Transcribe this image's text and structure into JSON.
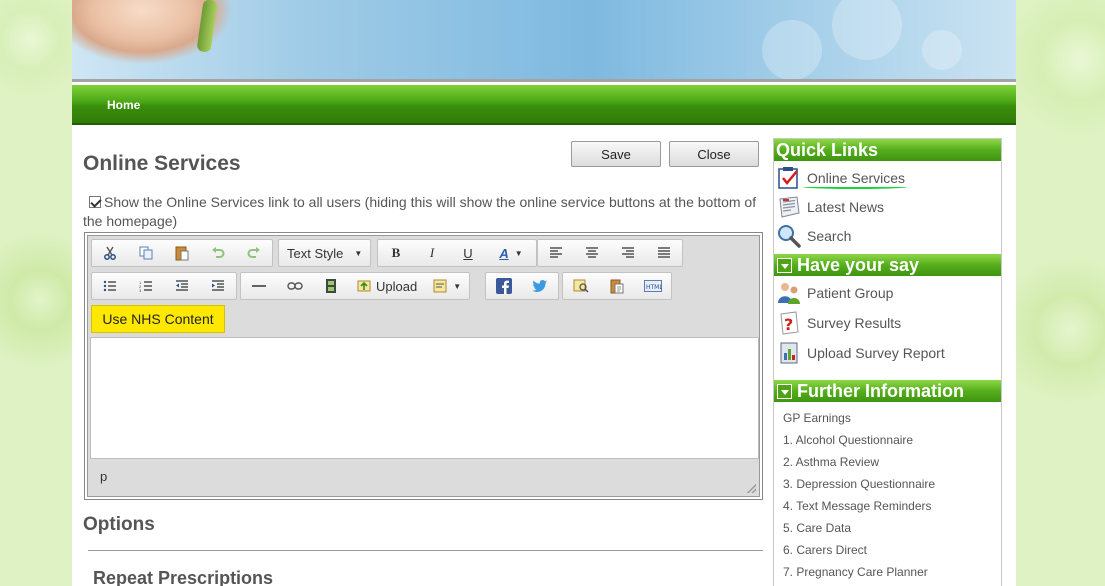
{
  "nav": {
    "home": "Home"
  },
  "page": {
    "title": "Online Services",
    "save_label": "Save",
    "close_label": "Close",
    "checkbox_text": "Show the Online Services link to all users (hiding this will show the online service buttons at the bottom of the homepage)",
    "checkbox_checked": true
  },
  "toolbar": {
    "text_style_label": "Text Style",
    "bold_label": "B",
    "italic_label": "I",
    "underline_label": "U",
    "font_color_label": "A",
    "upload_label": "Upload",
    "nhs_label": "Use NHS Content"
  },
  "editor": {
    "status_text": "p"
  },
  "sections": {
    "options": "Options",
    "repeat_prescriptions": "Repeat Prescriptions"
  },
  "sidebar": {
    "quick_links_title": "Quick Links",
    "quick_links": [
      {
        "label": "Online Services",
        "icon": "checklist-icon"
      },
      {
        "label": "Latest News",
        "icon": "newspaper-icon"
      },
      {
        "label": "Search",
        "icon": "magnifier-icon"
      }
    ],
    "have_your_say_title": "Have your say",
    "have_your_say": [
      {
        "label": "Patient Group",
        "icon": "people-icon"
      },
      {
        "label": "Survey Results",
        "icon": "question-icon"
      },
      {
        "label": "Upload Survey Report",
        "icon": "report-icon"
      }
    ],
    "further_info_title": "Further Information",
    "further_info": [
      "GP Earnings",
      "1. Alcohol Questionnaire",
      "2. Asthma Review",
      "3. Depression Questionnaire",
      "4. Text Message Reminders",
      "5. Care Data",
      "6. Carers Direct",
      "7. Pregnancy Care Planner"
    ]
  },
  "colors": {
    "nav_green": "#4aa614",
    "sidebar_header_green": "#56ae1c",
    "nhs_button_yellow": "#ffe800",
    "highlight_underline": "#14d63a"
  }
}
